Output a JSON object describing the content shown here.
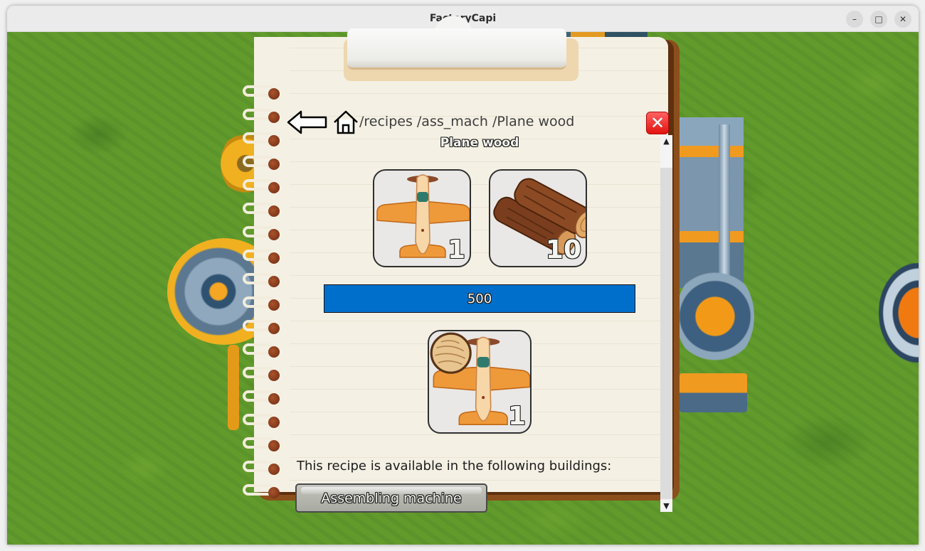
{
  "window": {
    "title": "FactoryCapi",
    "controls": {
      "minimize": "–",
      "maximize": "□",
      "close": "✕"
    }
  },
  "navigation": {
    "back_icon": "left-arrow-icon",
    "home_icon": "home-icon",
    "breadcrumb": [
      "/recipes",
      "/ass_mach",
      "/Plane wood"
    ],
    "close_icon": "✕"
  },
  "recipe": {
    "title": "Plane wood",
    "inputs": [
      {
        "name": "Plane",
        "icon": "plane-icon",
        "quantity": "1"
      },
      {
        "name": "Wood",
        "icon": "wood-logs-icon",
        "quantity": "10"
      }
    ],
    "craft_time": {
      "label": "500",
      "progress": 1.0
    },
    "outputs": [
      {
        "name": "Plane wood",
        "icon": "wooden-plane-icon",
        "quantity": "1"
      }
    ],
    "availability_text": "This recipe is available in the following buildings:",
    "buildings": [
      "Assembling machine"
    ]
  },
  "scrollbar": {
    "up": "▲",
    "down": "▼"
  },
  "colors": {
    "progress_bar": "#006fcc",
    "close_button": "#e3130f",
    "page": "#f4f0e4",
    "notebook_cover": "#8b4f1c",
    "grass": "#5f9a2c"
  }
}
